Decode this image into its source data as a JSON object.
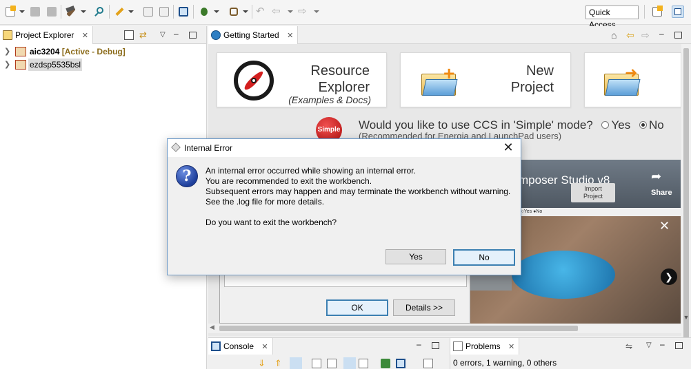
{
  "toolbar": {
    "icons": [
      "new-icon",
      "save-icon",
      "save-all-icon",
      "build-icon",
      "search-icon",
      "debug-launch-icon",
      "open-file-icon",
      "properties-icon",
      "terminal-icon",
      "debug-icon",
      "tool-icon",
      "back-disabled-icon",
      "back-icon",
      "forward-icon",
      "perspective-icon",
      "ccs-edit-icon"
    ],
    "quick_access": "Quick Access"
  },
  "left_pane": {
    "tab_label": "Project Explorer",
    "projects": [
      {
        "name": "aic3204",
        "status": "[Active - Debug]"
      },
      {
        "name": "ezdsp5535bsl",
        "status": ""
      }
    ]
  },
  "getting_started": {
    "tab_label": "Getting Started",
    "cards": [
      {
        "title_line1": "Resource",
        "title_line2": "Explorer",
        "subtitle": "(Examples & Docs)"
      },
      {
        "title_line1": "New",
        "title_line2": "Project",
        "subtitle": ""
      }
    ],
    "simple_badge": "Simple",
    "simple_question": "Would you like to use CCS in 'Simple' mode?",
    "simple_yes": "Yes",
    "simple_no": "No",
    "simple_selected": "No",
    "simple_note": "(Recommended for Energia and LaunchPad users)",
    "video_title": "mposer Studio v8",
    "video_card_label_1": "Import",
    "video_card_label_2": "Project",
    "video_overlay_text": "ode? ○Yes ●No",
    "video_share_label": "Share"
  },
  "underlying_dialog": {
    "ok_label": "OK",
    "details_label": "Details >>"
  },
  "error_dialog": {
    "title": "Internal Error",
    "line1": "An internal error occurred while showing an internal error.",
    "line2": "You are recommended to exit the workbench.",
    "line3": "Subsequent errors may happen and may terminate the workbench without warning.",
    "line4": "See the .log file for more details.",
    "question": "Do you want to exit the workbench?",
    "yes_label": "Yes",
    "no_label": "No"
  },
  "bottom": {
    "console_tab": "Console",
    "problems_tab": "Problems",
    "problems_status": "0 errors, 1 warning, 0 others"
  },
  "colors": {
    "accent_blue": "#3c7fb1",
    "active_status": "#8b6b1a",
    "simple_red": "#c8102e"
  }
}
